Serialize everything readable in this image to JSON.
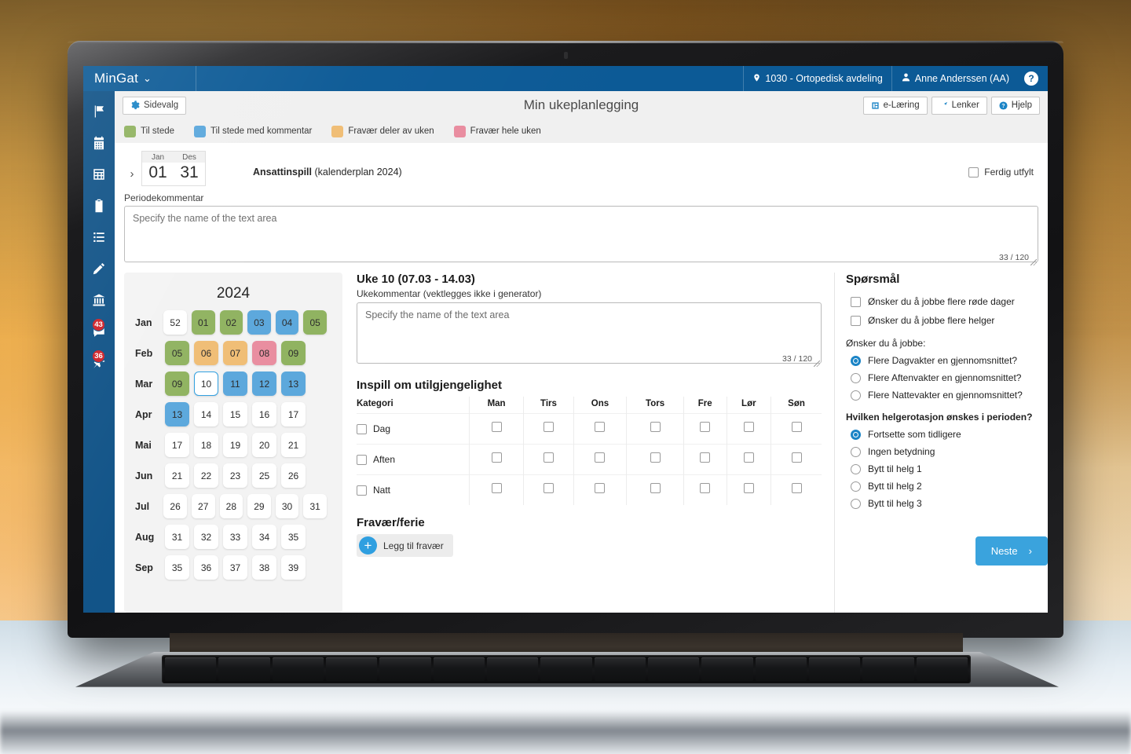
{
  "topbar": {
    "brand": "MinGat",
    "brand_caret": "⌄",
    "location_icon": "location-pin-icon",
    "location": "1030 - Ortopedisk avdeling",
    "user_icon": "user-icon",
    "user": "Anne Anderssen (AA)",
    "help": "?"
  },
  "sidenav": {
    "items": [
      {
        "name": "flag",
        "badge": ""
      },
      {
        "name": "calendar",
        "badge": ""
      },
      {
        "name": "table",
        "badge": ""
      },
      {
        "name": "clipboard",
        "badge": ""
      },
      {
        "name": "list",
        "badge": ""
      },
      {
        "name": "pencil",
        "badge": ""
      },
      {
        "name": "bank",
        "badge": ""
      },
      {
        "name": "chat",
        "badge": "43"
      },
      {
        "name": "pin",
        "badge": "36"
      }
    ]
  },
  "header": {
    "sidevalg": "Sidevalg",
    "title": "Min ukeplanlegging",
    "elearning": "e-Læring",
    "lenker": "Lenker",
    "hjelp": "Hjelp"
  },
  "legend": [
    {
      "label": "Til stede",
      "color": "#8fb25f"
    },
    {
      "label": "Til stede med kommentar",
      "color": "#5aa7dc"
    },
    {
      "label": "Fravær deler av uken",
      "color": "#f0bd74"
    },
    {
      "label": "Fravær hele uken",
      "color": "#e98c9f"
    }
  ],
  "period": {
    "chevron": "›",
    "from_month": "Jan",
    "from_day": "01",
    "to_month": "Des",
    "to_day": "31",
    "plan_name": "Ansattinspill",
    "plan_meta": "(kalenderplan 2024)",
    "ferdig_label": "Ferdig utfylt",
    "comment_label": "Periodekommentar",
    "comment_placeholder": "Specify the name of the text area",
    "comment_value": "",
    "comment_counter": "33 / 120"
  },
  "calendar": {
    "year": "2024",
    "rows": [
      {
        "month": "Jan",
        "weeks": [
          {
            "n": "52",
            "state": "none"
          },
          {
            "n": "01",
            "state": "green"
          },
          {
            "n": "02",
            "state": "green"
          },
          {
            "n": "03",
            "state": "blue"
          },
          {
            "n": "04",
            "state": "blue"
          },
          {
            "n": "05",
            "state": "green"
          }
        ]
      },
      {
        "month": "Feb",
        "weeks": [
          {
            "n": "05",
            "state": "green"
          },
          {
            "n": "06",
            "state": "orange"
          },
          {
            "n": "07",
            "state": "orange"
          },
          {
            "n": "08",
            "state": "pink"
          },
          {
            "n": "09",
            "state": "green"
          }
        ]
      },
      {
        "month": "Mar",
        "weeks": [
          {
            "n": "09",
            "state": "green"
          },
          {
            "n": "10",
            "state": "selected"
          },
          {
            "n": "11",
            "state": "blue"
          },
          {
            "n": "12",
            "state": "blue"
          },
          {
            "n": "13",
            "state": "blue"
          }
        ]
      },
      {
        "month": "Apr",
        "weeks": [
          {
            "n": "13",
            "state": "blue"
          },
          {
            "n": "14",
            "state": "none"
          },
          {
            "n": "15",
            "state": "none"
          },
          {
            "n": "16",
            "state": "none"
          },
          {
            "n": "17",
            "state": "none"
          }
        ]
      },
      {
        "month": "Mai",
        "weeks": [
          {
            "n": "17",
            "state": "none"
          },
          {
            "n": "18",
            "state": "none"
          },
          {
            "n": "19",
            "state": "none"
          },
          {
            "n": "20",
            "state": "none"
          },
          {
            "n": "21",
            "state": "none"
          }
        ]
      },
      {
        "month": "Jun",
        "weeks": [
          {
            "n": "21",
            "state": "none"
          },
          {
            "n": "22",
            "state": "none"
          },
          {
            "n": "23",
            "state": "none"
          },
          {
            "n": "25",
            "state": "none"
          },
          {
            "n": "26",
            "state": "none"
          }
        ]
      },
      {
        "month": "Jul",
        "weeks": [
          {
            "n": "26",
            "state": "none"
          },
          {
            "n": "27",
            "state": "none"
          },
          {
            "n": "28",
            "state": "none"
          },
          {
            "n": "29",
            "state": "none"
          },
          {
            "n": "30",
            "state": "none"
          },
          {
            "n": "31",
            "state": "none"
          }
        ]
      },
      {
        "month": "Aug",
        "weeks": [
          {
            "n": "31",
            "state": "none"
          },
          {
            "n": "32",
            "state": "none"
          },
          {
            "n": "33",
            "state": "none"
          },
          {
            "n": "34",
            "state": "none"
          },
          {
            "n": "35",
            "state": "none"
          }
        ]
      },
      {
        "month": "Sep",
        "weeks": [
          {
            "n": "35",
            "state": "none"
          },
          {
            "n": "36",
            "state": "none"
          },
          {
            "n": "37",
            "state": "none"
          },
          {
            "n": "38",
            "state": "none"
          },
          {
            "n": "39",
            "state": "none"
          }
        ]
      }
    ],
    "colors": {
      "green": "#8fb25f",
      "blue": "#5aa7dc",
      "orange": "#f0bd74",
      "pink": "#e98c9f",
      "none": "#ffffff",
      "selected_border": "#2f9fe0"
    }
  },
  "week": {
    "title": "Uke 10 (07.03 - 14.03)",
    "comment_label": "Ukekommentar (vektlegges ikke i generator)",
    "comment_placeholder": "Specify the name of the text area",
    "comment_value": "",
    "comment_counter": "33 / 120",
    "unavail_title": "Inspill om utilgjengelighet",
    "columns": [
      "Kategori",
      "Man",
      "Tirs",
      "Ons",
      "Tors",
      "Fre",
      "Lør",
      "Søn"
    ],
    "rows": [
      {
        "category": "Dag",
        "checked": [
          false,
          false,
          false,
          false,
          false,
          false,
          false
        ],
        "cat_checked": false
      },
      {
        "category": "Aften",
        "checked": [
          false,
          false,
          false,
          false,
          false,
          false,
          false
        ],
        "cat_checked": false
      },
      {
        "category": "Natt",
        "checked": [
          false,
          false,
          false,
          false,
          false,
          false,
          false
        ],
        "cat_checked": false
      }
    ],
    "absence_title": "Fravær/ferie",
    "add_absence": "Legg til fravær",
    "add_icon": "plus-icon"
  },
  "questions": {
    "title": "Spørsmål",
    "checkboxes": [
      {
        "label": "Ønsker du å jobbe  flere røde dager",
        "checked": false
      },
      {
        "label": "Ønsker du å jobbe flere helger",
        "checked": false
      }
    ],
    "group1_label": "Ønsker du å jobbe:",
    "group1": [
      {
        "label": "Flere Dagvakter en gjennomsnittet?",
        "selected": true
      },
      {
        "label": "Flere Aftenvakter en gjennomsnittet?",
        "selected": false
      },
      {
        "label": "Flere Nattevakter en gjennomsnittet?",
        "selected": false
      }
    ],
    "group2_label": "Hvilken helgerotasjon ønskes i perioden?",
    "group2": [
      {
        "label": "Fortsette som tidligere",
        "selected": true
      },
      {
        "label": "Ingen betydning",
        "selected": false
      },
      {
        "label": "Bytt til helg 1",
        "selected": false
      },
      {
        "label": "Bytt til helg 2",
        "selected": false
      },
      {
        "label": "Bytt til helg 3",
        "selected": false
      }
    ],
    "next_label": "Neste",
    "next_chevron": "›"
  }
}
